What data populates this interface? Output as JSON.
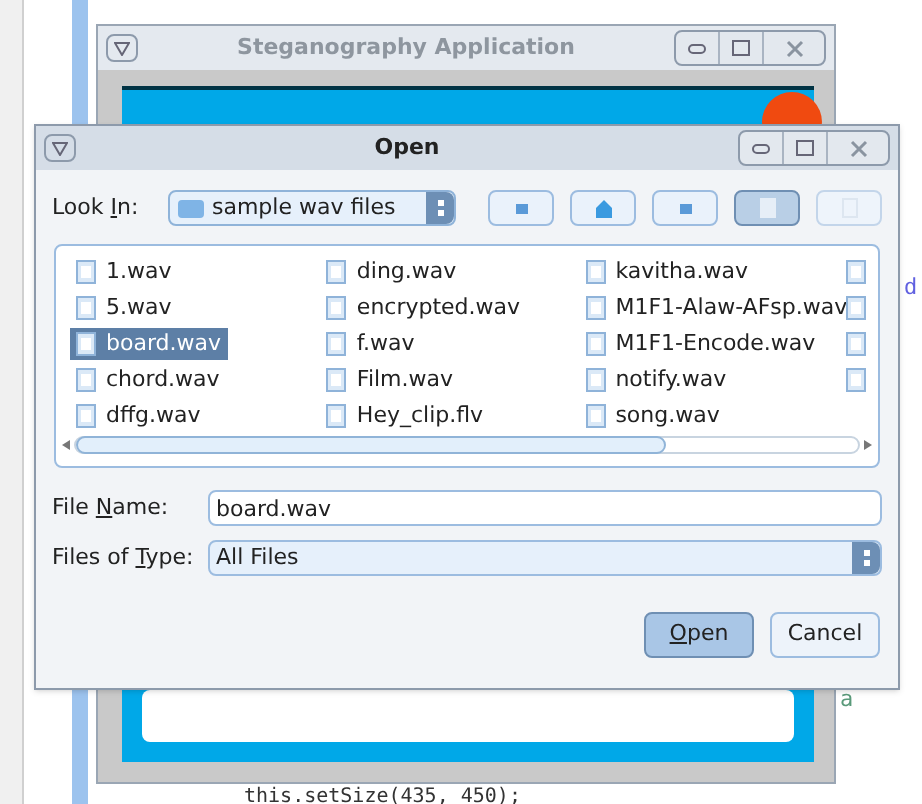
{
  "background_window": {
    "title": "Steganography Application"
  },
  "code": [
    {
      "text": "d"
    },
    {
      "text": "a"
    },
    {
      "text": "this.setSize(435, 450);"
    }
  ],
  "dialog": {
    "title": "Open",
    "look_in": {
      "label": [
        {
          "text": "Look ",
          "underlined": false
        },
        {
          "text": "I",
          "underlined": true
        },
        {
          "text": "n:",
          "underlined": false
        }
      ],
      "value": "sample wav files"
    },
    "view_buttons": [
      {
        "selected": true
      },
      {
        "selected": false
      }
    ],
    "files": [
      {
        "kind": "file",
        "name": "1.wav",
        "selected": false
      },
      {
        "kind": "file",
        "name": "5.wav",
        "selected": false
      },
      {
        "kind": "file",
        "name": "board.wav",
        "selected": true
      },
      {
        "kind": "file",
        "name": "chord.wav",
        "selected": false
      },
      {
        "kind": "file",
        "name": "dffg.wav",
        "selected": false
      },
      {
        "kind": "file",
        "name": "ding.wav",
        "selected": false
      },
      {
        "kind": "file",
        "name": "encrypted.wav",
        "selected": false
      },
      {
        "kind": "file",
        "name": "f.wav",
        "selected": false
      },
      {
        "kind": "file",
        "name": "Film.wav",
        "selected": false
      },
      {
        "kind": "file",
        "name": "Hey_clip.flv",
        "selected": false
      },
      {
        "kind": "file",
        "name": "kavitha.wav",
        "selected": false
      },
      {
        "kind": "file",
        "name": "M1F1-Alaw-AFsp.wav",
        "selected": false
      },
      {
        "kind": "file",
        "name": "M1F1-Encode.wav",
        "selected": false
      },
      {
        "kind": "file",
        "name": "notify.wav",
        "selected": false
      },
      {
        "kind": "file",
        "name": "song.wav",
        "selected": false
      },
      {
        "kind": "clipped",
        "selected": false
      },
      {
        "kind": "clipped",
        "selected": false
      },
      {
        "kind": "clipped",
        "selected": false
      },
      {
        "kind": "clipped",
        "selected": false
      }
    ],
    "file_name": {
      "label": [
        {
          "text": "File ",
          "underlined": false
        },
        {
          "text": "N",
          "underlined": true
        },
        {
          "text": "ame:",
          "underlined": false
        }
      ],
      "value": "board.wav"
    },
    "files_of_type": {
      "label": [
        {
          "text": "Files of ",
          "underlined": false
        },
        {
          "text": "T",
          "underlined": true
        },
        {
          "text": "ype:",
          "underlined": false
        }
      ],
      "value": "All Files"
    },
    "buttons": [
      {
        "label": [
          {
            "text": "O",
            "underlined": true
          },
          {
            "text": "pen",
            "underlined": false
          }
        ],
        "default": true
      },
      {
        "label": [
          {
            "text": "Cancel",
            "underlined": false
          }
        ],
        "default": false
      }
    ]
  }
}
